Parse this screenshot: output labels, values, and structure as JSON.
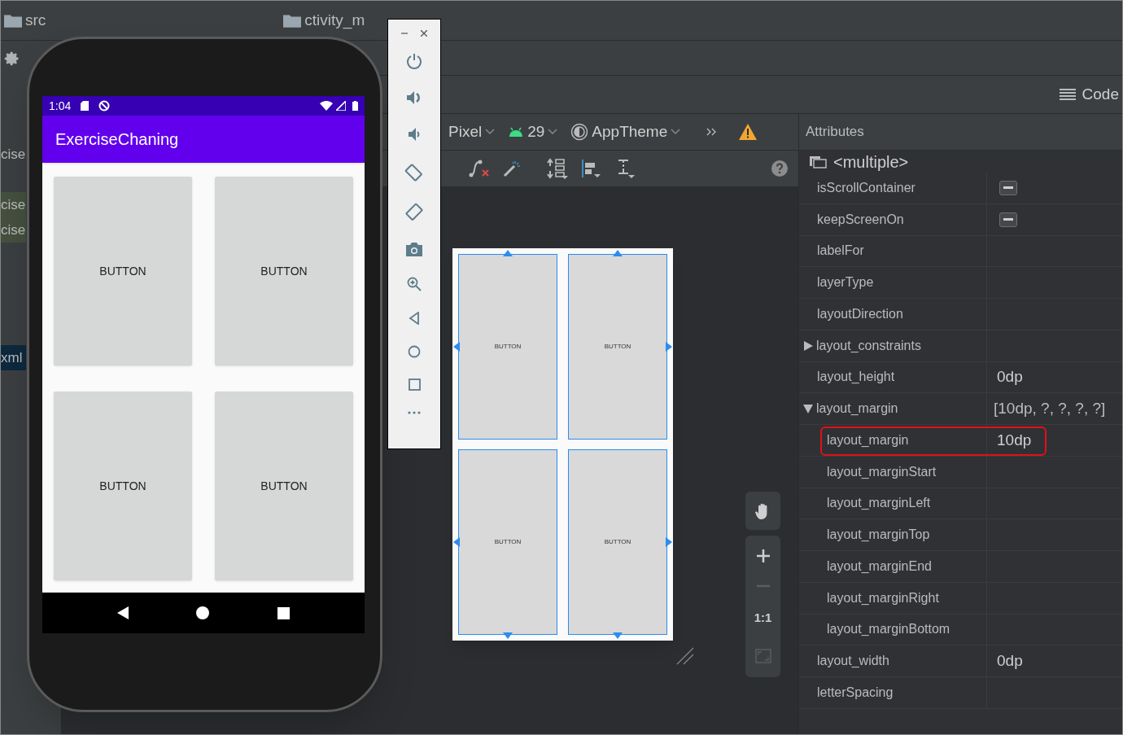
{
  "breadcrumbs": [
    "src",
    "ctivity_m"
  ],
  "project_items": [
    {
      "text": "cise",
      "kind": "plain"
    },
    {
      "text": "cise",
      "kind": "modified"
    },
    {
      "text": "cise",
      "kind": "modified"
    },
    {
      "text": "xml",
      "kind": "selected"
    }
  ],
  "view_mode": "Code",
  "toolbar": {
    "device": "Pixel",
    "api": "29",
    "theme": "AppTheme"
  },
  "blueprint": {
    "buttons": [
      "BUTTON",
      "BUTTON",
      "BUTTON",
      "BUTTON"
    ]
  },
  "zoom_controls": {
    "reset": "1:1"
  },
  "attributes": {
    "title": "Attributes",
    "selection": "<multiple>",
    "rows": [
      {
        "name": "isScrollContainer",
        "kind": "tristate",
        "indeterminate": true
      },
      {
        "name": "keepScreenOn",
        "kind": "tristate",
        "indeterminate": true
      },
      {
        "name": "labelFor",
        "kind": "text"
      },
      {
        "name": "layerType",
        "kind": "text"
      },
      {
        "name": "layoutDirection",
        "kind": "text"
      },
      {
        "name": "layout_constraints",
        "kind": "group",
        "expanded": false
      },
      {
        "name": "layout_height",
        "kind": "text",
        "value": "0dp"
      },
      {
        "name": "layout_margin",
        "kind": "group",
        "expanded": true,
        "value": "[10dp, ?, ?, ?, ?]",
        "children": [
          {
            "name": "layout_margin",
            "value": "10dp",
            "highlighted": true
          },
          {
            "name": "layout_marginStart",
            "highlighted": false
          },
          {
            "name": "layout_marginLeft",
            "highlighted": false
          },
          {
            "name": "layout_marginTop",
            "highlighted": false
          },
          {
            "name": "layout_marginEnd",
            "highlighted": false
          },
          {
            "name": "layout_marginRight",
            "highlighted": false
          },
          {
            "name": "layout_marginBottom",
            "highlighted": false
          }
        ]
      },
      {
        "name": "layout_width",
        "kind": "text",
        "value": "0dp"
      },
      {
        "name": "letterSpacing",
        "kind": "text"
      }
    ]
  },
  "phone": {
    "time": "1:04",
    "app_title": "ExerciseChaning",
    "buttons": [
      "BUTTON",
      "BUTTON",
      "BUTTON",
      "BUTTON"
    ]
  }
}
